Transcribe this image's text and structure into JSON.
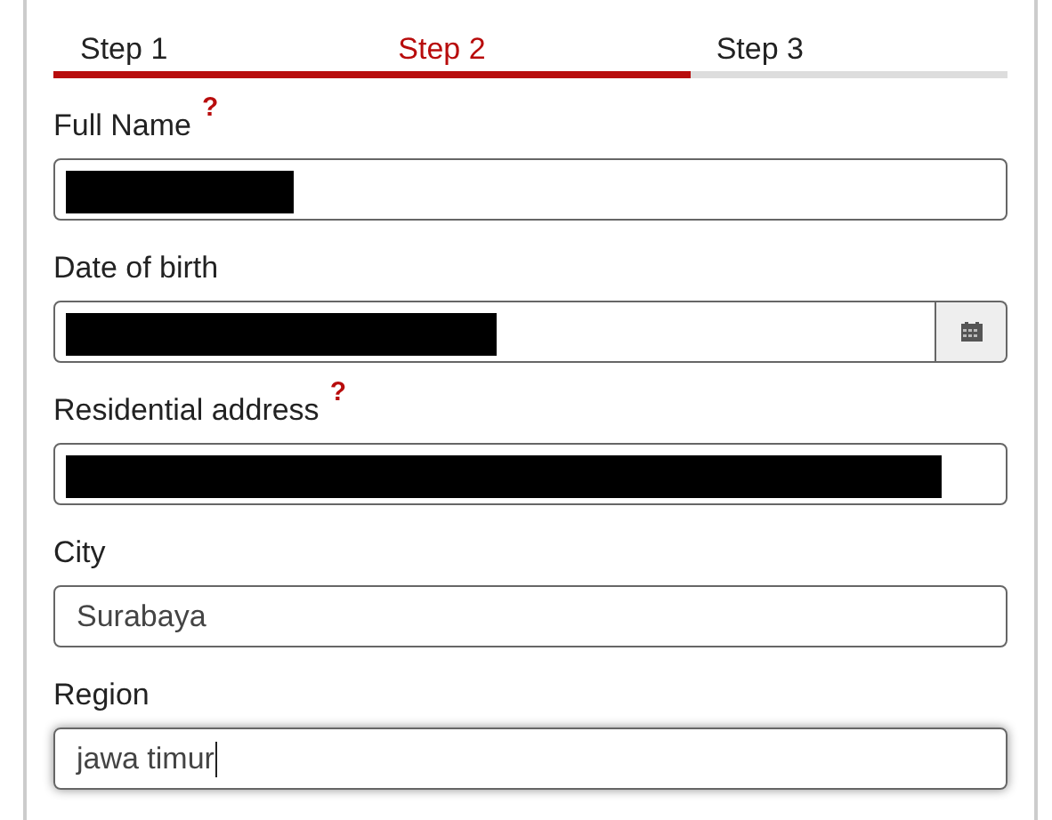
{
  "steps": [
    {
      "label": "Step 1",
      "selected": false
    },
    {
      "label": "Step 2",
      "selected": true
    },
    {
      "label": "Step 3",
      "selected": false
    }
  ],
  "progress": {
    "level": 0.667
  },
  "fields": [
    {
      "label": "Full Name",
      "help": "?",
      "redacted": true,
      "focused": false
    },
    {
      "label": "Date of birth",
      "redacted": true,
      "picker": true,
      "focused": false
    },
    {
      "label": "Residential address",
      "help": "?",
      "redacted": true,
      "focused": false
    },
    {
      "label": "City",
      "value": "Surabaya",
      "redacted": false,
      "focused": false
    },
    {
      "label": "Region",
      "value": "jawa timur",
      "redacted": false,
      "focused": true
    }
  ]
}
